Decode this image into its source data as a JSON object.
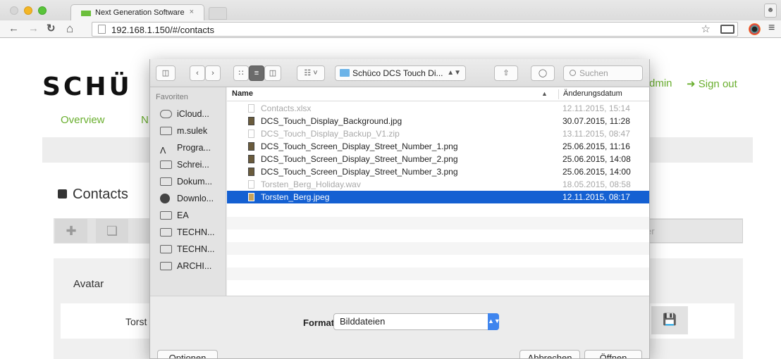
{
  "browser": {
    "tab_title": "Next Generation Software",
    "tab_close": "×",
    "url": "192.168.1.150/#/contacts"
  },
  "page": {
    "logo": "SCHÜ",
    "admin": "dmin",
    "signout": "Sign out",
    "nav": {
      "overview": "Overview",
      "n": "N"
    },
    "section_title": "Contacts",
    "search_tail": "er",
    "avatar_label": "Avatar",
    "name_partial": "Torst"
  },
  "dialog": {
    "path": "Schüco DCS Touch Di...",
    "search_placeholder": "Suchen",
    "sidebar": {
      "heading": "Favoriten",
      "items": [
        "iCloud...",
        "m.sulek",
        "Progra...",
        "Schrei...",
        "Dokum...",
        "Downlo...",
        "EA",
        "TECHN...",
        "TECHN...",
        "ARCHI..."
      ]
    },
    "columns": {
      "name": "Name",
      "date": "Änderungsdatum"
    },
    "files": [
      {
        "name": "Contacts.xlsx",
        "date": "12.11.2015, 15:14",
        "state": "dim"
      },
      {
        "name": "DCS_Touch_Display_Background.jpg",
        "date": "30.07.2015, 11:28",
        "state": "normal"
      },
      {
        "name": "DCS_Touch_Display_Backup_V1.zip",
        "date": "13.11.2015, 08:47",
        "state": "dim"
      },
      {
        "name": "DCS_Touch_Screen_Display_Street_Number_1.png",
        "date": "25.06.2015, 11:16",
        "state": "normal"
      },
      {
        "name": "DCS_Touch_Screen_Display_Street_Number_2.png",
        "date": "25.06.2015, 14:08",
        "state": "normal"
      },
      {
        "name": "DCS_Touch_Screen_Display_Street_Number_3.png",
        "date": "25.06.2015, 14:00",
        "state": "normal"
      },
      {
        "name": "Torsten_Berg_Holiday.wav",
        "date": "18.05.2015, 08:58",
        "state": "dim"
      },
      {
        "name": "Torsten_Berg.jpeg",
        "date": "12.11.2015, 08:17",
        "state": "selected"
      }
    ],
    "format_label": "Format:",
    "format_value": "Bilddateien",
    "options_button": "Optionen",
    "cancel_button": "Abbrechen",
    "open_button": "Öffnen"
  },
  "colors": {
    "accent_green": "#6aaf2f",
    "selection_blue": "#1460d2"
  }
}
